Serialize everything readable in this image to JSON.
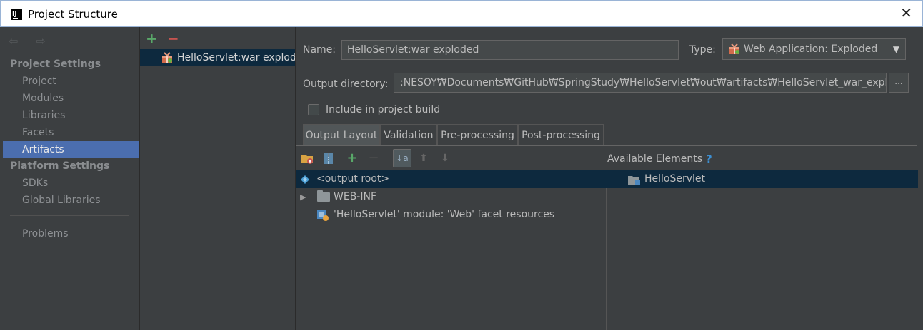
{
  "window": {
    "title": "Project Structure",
    "close_glyph": "✕"
  },
  "sidebar": {
    "nav_arrows": "⇦ ⇨",
    "project_settings_header": "Project Settings",
    "items_ps": [
      {
        "label": "Project"
      },
      {
        "label": "Modules"
      },
      {
        "label": "Libraries"
      },
      {
        "label": "Facets"
      },
      {
        "label": "Artifacts"
      }
    ],
    "platform_settings_header": "Platform Settings",
    "items_pl": [
      {
        "label": "SDKs"
      },
      {
        "label": "Global Libraries"
      }
    ],
    "problems_label": "Problems",
    "selected": "Artifacts"
  },
  "artifacts_list": {
    "add_glyph": "+",
    "remove_glyph": "−",
    "items": [
      {
        "label": "HelloServlet:war exploded",
        "icon": "war-icon"
      }
    ]
  },
  "details": {
    "name_label": "Name:",
    "name_value": "HelloServlet:war exploded",
    "type_label": "Type:",
    "type_value": "Web Application: Exploded",
    "type_arrow": "▼",
    "output_label": "Output directory:",
    "output_value": ":NESOY₩Documents₩GitHub₩SpringStudy₩HelloServlet₩out₩artifacts₩HelloServlet_war_exploded",
    "browse_glyph": "...",
    "include_label": "Include in project build",
    "include_checked": false
  },
  "tabs": [
    {
      "label": "Output Layout",
      "active": true
    },
    {
      "label": "Validation",
      "active": false
    },
    {
      "label": "Pre-processing",
      "active": false
    },
    {
      "label": "Post-processing",
      "active": false
    }
  ],
  "layout_toolbar": {
    "icons": [
      "create-directory-icon",
      "add-archive-icon",
      "add-copy-icon",
      "remove-icon",
      "sort-alphabetically-icon",
      "move-up-icon",
      "move-down-icon"
    ],
    "plus_glyph": "+",
    "minus_glyph": "−",
    "sort_glyph": "↓a z",
    "up_glyph": "⬆",
    "down_glyph": "⬇",
    "available_label": "Available Elements",
    "help_glyph": "?"
  },
  "layout_tree": [
    {
      "label": "<output root>",
      "icon": "output-root-icon",
      "selected": true
    },
    {
      "label": "WEB-INF",
      "icon": "folder-icon",
      "expandable": true,
      "expander": "▶"
    },
    {
      "label": "'HelloServlet' module: 'Web' facet resources",
      "icon": "web-facet-icon"
    }
  ],
  "available_tree": [
    {
      "label": "HelloServlet",
      "icon": "module-folder-icon",
      "selected": true
    }
  ],
  "colors": {
    "background": "#3c3f41",
    "selection": "#4b6eaf",
    "tree_selection": "#0d293e",
    "add_green": "#59a869",
    "remove_red": "#c75450",
    "help_blue": "#3d8fd1"
  }
}
